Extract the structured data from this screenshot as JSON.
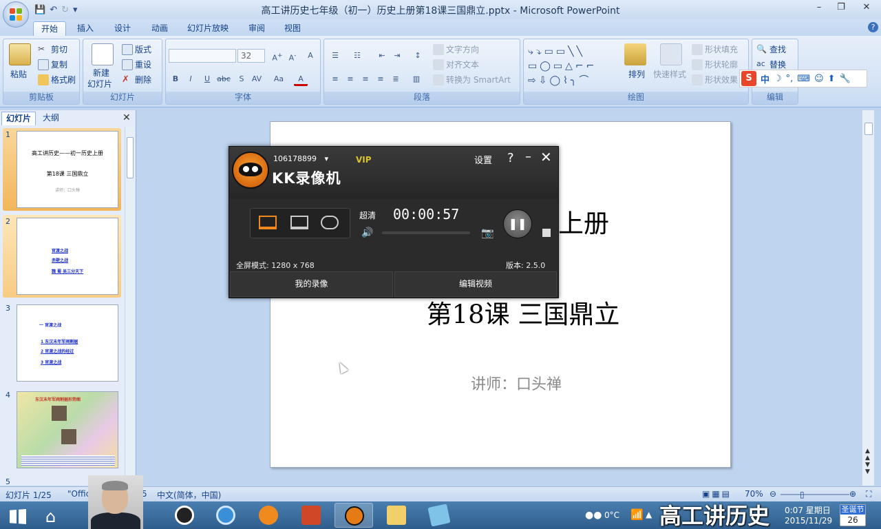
{
  "window": {
    "title": "高工讲历史七年级（初一）历史上册第18课三国鼎立.pptx - Microsoft PowerPoint",
    "minimize": "–",
    "restore": "❐",
    "close": "✕"
  },
  "ribbon_tabs": [
    "开始",
    "插入",
    "设计",
    "动画",
    "幻灯片放映",
    "审阅",
    "视图"
  ],
  "ribbon": {
    "clipboard": {
      "label": "剪贴板",
      "paste": "粘贴",
      "cut": "剪切",
      "copy": "复制",
      "format_painter": "格式刷"
    },
    "slides": {
      "label": "幻灯片",
      "new_slide": "新建\n幻灯片",
      "new_slide_a": "新建",
      "new_slide_b": "幻灯片",
      "layout": "版式",
      "reset": "重设",
      "delete": "删除"
    },
    "font": {
      "label": "字体",
      "size": "32"
    },
    "paragraph": {
      "label": "段落",
      "text_direction": "文字方向",
      "align_text": "对齐文本",
      "smartart": "转换为 SmartArt"
    },
    "drawing": {
      "label": "绘图",
      "arrange": "排列",
      "quick_styles": "快速样式",
      "shape_fill": "形状填充",
      "shape_outline": "形状轮廓",
      "shape_effects": "形状效果"
    },
    "editing": {
      "label": "编辑",
      "find": "查找",
      "replace": "替换"
    }
  },
  "left_pane": {
    "tab_slides": "幻灯片",
    "tab_outline": "大纲",
    "close": "✕",
    "slides": [
      {
        "num": "1",
        "title": "高工讲历史——初一历史上册",
        "sub": "第18课 三国鼎立",
        "small": "讲师：口头禅"
      },
      {
        "num": "2",
        "items": [
          "官渡之战",
          "赤壁之战",
          "魏 蜀 吴三分天下"
        ]
      },
      {
        "num": "3",
        "heading": "一  官渡之战",
        "items": [
          "1 东汉末年军阀割据",
          "2 官渡之战的经过",
          "3 官渡之战"
        ]
      },
      {
        "num": "4",
        "heading": "东汉末年军阀割据形势图"
      },
      {
        "num": "5"
      }
    ]
  },
  "slide": {
    "title": "一历史上册",
    "subtitle": "第18课 三国鼎立",
    "lecturer": "讲师：口头禅"
  },
  "kk": {
    "account": "106178899",
    "vip": "VIP",
    "name": "KK录像机",
    "settings": "设置",
    "help": "?",
    "minimize": "–",
    "close": "✕",
    "quality": "超清",
    "time": "00:00:57",
    "mode_info": "全屏模式: 1280 x 768",
    "version": "版本: 2.5.0",
    "my_recordings": "我的录像",
    "edit_video": "编辑视频"
  },
  "status_bar": {
    "slide_count": "幻灯片 1/25",
    "theme": "\"Offic",
    "theme_suffix": "5",
    "language": "中文(简体，中国)",
    "zoom": "70%"
  },
  "taskbar": {
    "weather": "0°C",
    "time": "0:07 星期日",
    "date": "2015/11/29",
    "holiday": "圣诞节",
    "holiday_day": "26"
  },
  "caption": "高工讲历史",
  "ime": {
    "mode": "中"
  }
}
